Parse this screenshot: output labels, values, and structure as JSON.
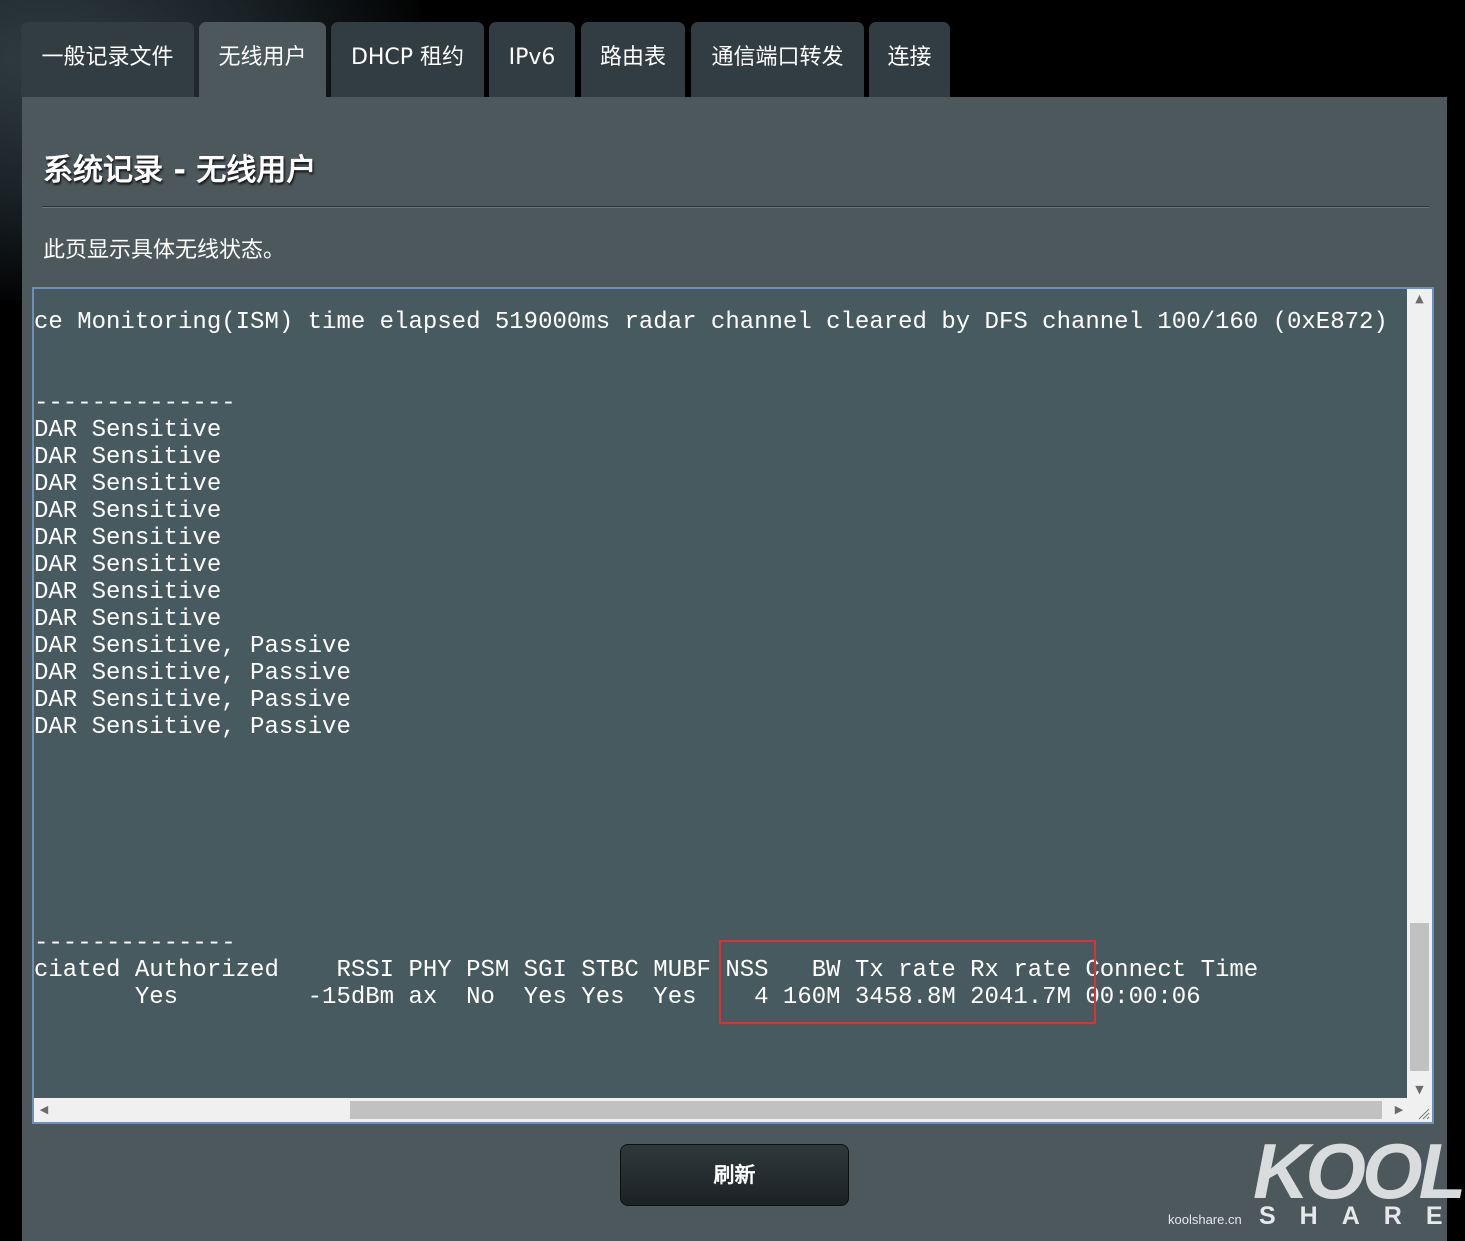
{
  "tabs": [
    {
      "label": "一般记录文件"
    },
    {
      "label": "无线用户"
    },
    {
      "label": "DHCP 租约"
    },
    {
      "label": "IPv6"
    },
    {
      "label": "路由表"
    },
    {
      "label": "通信端口转发"
    },
    {
      "label": "连接"
    }
  ],
  "page": {
    "title": "系统记录 - 无线用户",
    "description": "此页显示具体无线状态。"
  },
  "log": {
    "lines": [
      "ce Monitoring(ISM) time elapsed 519000ms radar channel cleared by DFS channel 100/160 (0xE872)",
      "",
      "",
      "--------------",
      "DAR Sensitive",
      "DAR Sensitive",
      "DAR Sensitive",
      "DAR Sensitive",
      "DAR Sensitive",
      "DAR Sensitive",
      "DAR Sensitive",
      "DAR Sensitive",
      "DAR Sensitive, Passive",
      "DAR Sensitive, Passive",
      "DAR Sensitive, Passive",
      "DAR Sensitive, Passive",
      "",
      "",
      "",
      "",
      "",
      "",
      "",
      "--------------",
      "ciated Authorized    RSSI PHY PSM SGI STBC MUBF NSS   BW Tx rate Rx rate Connect Time",
      "       Yes         -15dBm ax  No  Yes Yes  Yes    4 160M 3458.8M 2041.7M 00:00:06"
    ]
  },
  "buttons": {
    "refresh": "刷新"
  },
  "watermark": {
    "brand": "KOOL",
    "sub": "SHARE",
    "domain": "koolshare.cn"
  },
  "icons": {
    "scroll_up": "triangle-up-icon",
    "scroll_down": "triangle-down-icon",
    "scroll_left": "triangle-left-icon",
    "scroll_right": "triangle-right-icon",
    "resize": "resize-grip-icon"
  },
  "colors": {
    "panel": "#4d585c",
    "tab": "#313d42",
    "tab_active": "#4c585c",
    "log_bg": "#475a5f",
    "highlight": "#e03030"
  }
}
